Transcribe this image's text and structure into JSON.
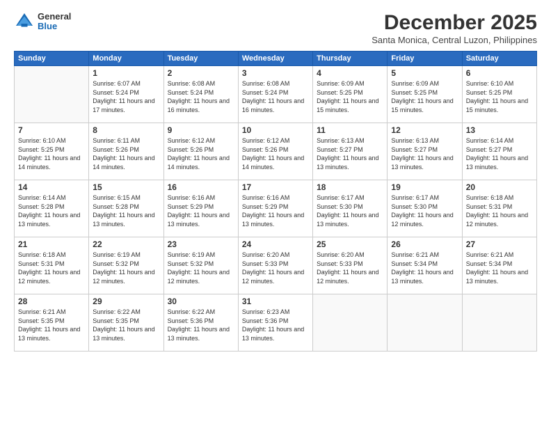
{
  "logo": {
    "general": "General",
    "blue": "Blue"
  },
  "title": "December 2025",
  "location": "Santa Monica, Central Luzon, Philippines",
  "days_header": [
    "Sunday",
    "Monday",
    "Tuesday",
    "Wednesday",
    "Thursday",
    "Friday",
    "Saturday"
  ],
  "weeks": [
    [
      {
        "day": "",
        "empty": true
      },
      {
        "day": "1",
        "sunrise": "6:07 AM",
        "sunset": "5:24 PM",
        "daylight": "11 hours and 17 minutes."
      },
      {
        "day": "2",
        "sunrise": "6:08 AM",
        "sunset": "5:24 PM",
        "daylight": "11 hours and 16 minutes."
      },
      {
        "day": "3",
        "sunrise": "6:08 AM",
        "sunset": "5:24 PM",
        "daylight": "11 hours and 16 minutes."
      },
      {
        "day": "4",
        "sunrise": "6:09 AM",
        "sunset": "5:25 PM",
        "daylight": "11 hours and 15 minutes."
      },
      {
        "day": "5",
        "sunrise": "6:09 AM",
        "sunset": "5:25 PM",
        "daylight": "11 hours and 15 minutes."
      },
      {
        "day": "6",
        "sunrise": "6:10 AM",
        "sunset": "5:25 PM",
        "daylight": "11 hours and 15 minutes."
      }
    ],
    [
      {
        "day": "7",
        "sunrise": "6:10 AM",
        "sunset": "5:25 PM",
        "daylight": "11 hours and 14 minutes."
      },
      {
        "day": "8",
        "sunrise": "6:11 AM",
        "sunset": "5:26 PM",
        "daylight": "11 hours and 14 minutes."
      },
      {
        "day": "9",
        "sunrise": "6:12 AM",
        "sunset": "5:26 PM",
        "daylight": "11 hours and 14 minutes."
      },
      {
        "day": "10",
        "sunrise": "6:12 AM",
        "sunset": "5:26 PM",
        "daylight": "11 hours and 14 minutes."
      },
      {
        "day": "11",
        "sunrise": "6:13 AM",
        "sunset": "5:27 PM",
        "daylight": "11 hours and 13 minutes."
      },
      {
        "day": "12",
        "sunrise": "6:13 AM",
        "sunset": "5:27 PM",
        "daylight": "11 hours and 13 minutes."
      },
      {
        "day": "13",
        "sunrise": "6:14 AM",
        "sunset": "5:27 PM",
        "daylight": "11 hours and 13 minutes."
      }
    ],
    [
      {
        "day": "14",
        "sunrise": "6:14 AM",
        "sunset": "5:28 PM",
        "daylight": "11 hours and 13 minutes."
      },
      {
        "day": "15",
        "sunrise": "6:15 AM",
        "sunset": "5:28 PM",
        "daylight": "11 hours and 13 minutes."
      },
      {
        "day": "16",
        "sunrise": "6:16 AM",
        "sunset": "5:29 PM",
        "daylight": "11 hours and 13 minutes."
      },
      {
        "day": "17",
        "sunrise": "6:16 AM",
        "sunset": "5:29 PM",
        "daylight": "11 hours and 13 minutes."
      },
      {
        "day": "18",
        "sunrise": "6:17 AM",
        "sunset": "5:30 PM",
        "daylight": "11 hours and 13 minutes."
      },
      {
        "day": "19",
        "sunrise": "6:17 AM",
        "sunset": "5:30 PM",
        "daylight": "11 hours and 12 minutes."
      },
      {
        "day": "20",
        "sunrise": "6:18 AM",
        "sunset": "5:31 PM",
        "daylight": "11 hours and 12 minutes."
      }
    ],
    [
      {
        "day": "21",
        "sunrise": "6:18 AM",
        "sunset": "5:31 PM",
        "daylight": "11 hours and 12 minutes."
      },
      {
        "day": "22",
        "sunrise": "6:19 AM",
        "sunset": "5:32 PM",
        "daylight": "11 hours and 12 minutes."
      },
      {
        "day": "23",
        "sunrise": "6:19 AM",
        "sunset": "5:32 PM",
        "daylight": "11 hours and 12 minutes."
      },
      {
        "day": "24",
        "sunrise": "6:20 AM",
        "sunset": "5:33 PM",
        "daylight": "11 hours and 12 minutes."
      },
      {
        "day": "25",
        "sunrise": "6:20 AM",
        "sunset": "5:33 PM",
        "daylight": "11 hours and 12 minutes."
      },
      {
        "day": "26",
        "sunrise": "6:21 AM",
        "sunset": "5:34 PM",
        "daylight": "11 hours and 13 minutes."
      },
      {
        "day": "27",
        "sunrise": "6:21 AM",
        "sunset": "5:34 PM",
        "daylight": "11 hours and 13 minutes."
      }
    ],
    [
      {
        "day": "28",
        "sunrise": "6:21 AM",
        "sunset": "5:35 PM",
        "daylight": "11 hours and 13 minutes."
      },
      {
        "day": "29",
        "sunrise": "6:22 AM",
        "sunset": "5:35 PM",
        "daylight": "11 hours and 13 minutes."
      },
      {
        "day": "30",
        "sunrise": "6:22 AM",
        "sunset": "5:36 PM",
        "daylight": "11 hours and 13 minutes."
      },
      {
        "day": "31",
        "sunrise": "6:23 AM",
        "sunset": "5:36 PM",
        "daylight": "11 hours and 13 minutes."
      },
      {
        "day": "",
        "empty": true
      },
      {
        "day": "",
        "empty": true
      },
      {
        "day": "",
        "empty": true
      }
    ]
  ]
}
